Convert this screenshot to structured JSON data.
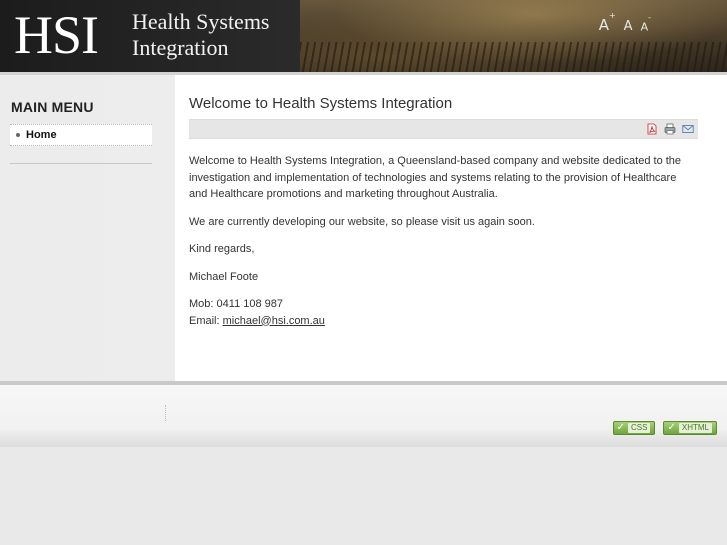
{
  "header": {
    "logo_abbr": "HSI",
    "logo_line1": "Health Systems",
    "logo_line2": "Integration",
    "font_increase": "A",
    "font_default": "A",
    "font_decrease": "A",
    "font_increase_sign": "+",
    "font_decrease_sign": "-"
  },
  "sidebar": {
    "title": "MAIN MENU",
    "items": [
      {
        "label": "Home"
      }
    ]
  },
  "main": {
    "title": "Welcome to Health Systems Integration",
    "toolbar_icons": [
      "pdf-icon",
      "print-icon",
      "email-icon"
    ],
    "paragraphs": [
      "Welcome to Health Systems Integration, a Queensland-based company and website dedicated to the investigation and implementation of technologies and systems relating to the provision of Healthcare and Healthcare promotions and marketing throughout Australia.",
      "We are currently developing our website, so please visit us again soon.",
      "Kind regards,",
      "Michael Foote"
    ],
    "mob_label": "Mob:",
    "mob_value": "0411 108 987",
    "email_label": "Email:",
    "email_value": "michael@hsi.com.au"
  },
  "footer": {
    "badge_css": "CSS",
    "badge_xhtml": "XHTML"
  },
  "colors": {
    "header_bg": "#2a2a2a",
    "badge_green": "#6fa43e",
    "sidebar_bg": "#ececec"
  }
}
